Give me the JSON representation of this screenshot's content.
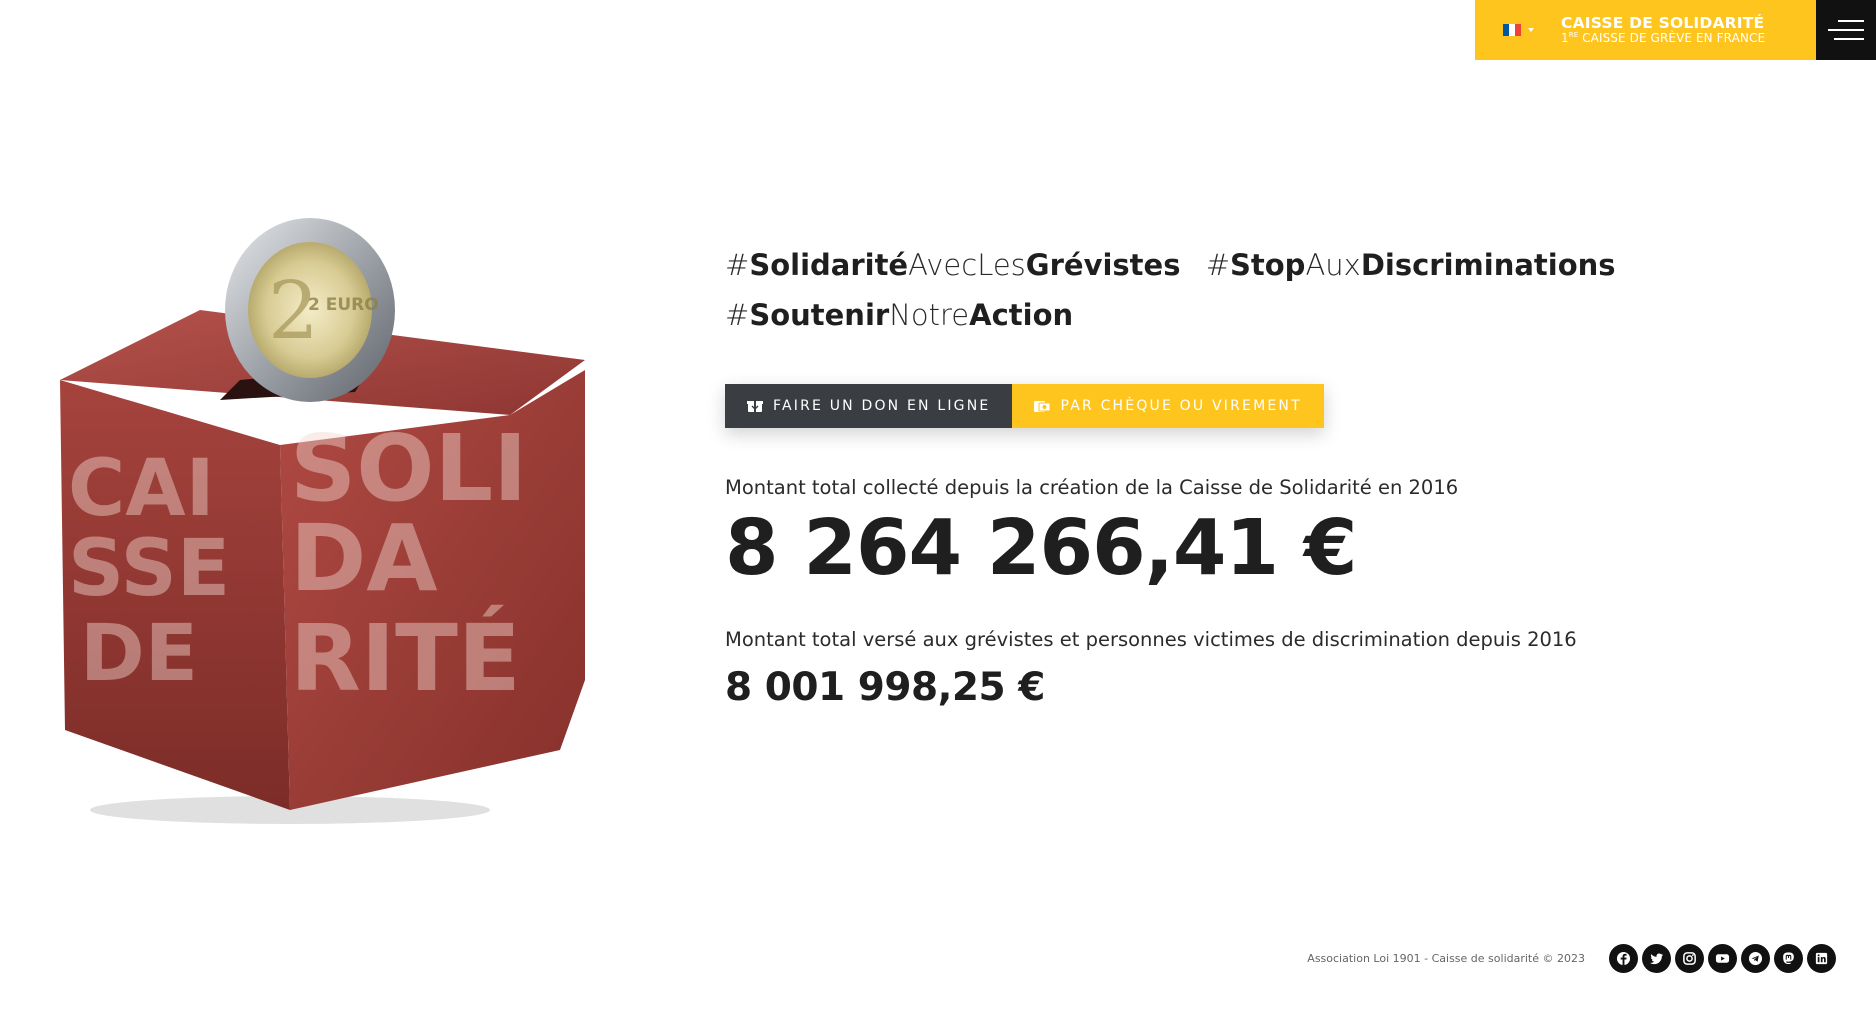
{
  "header": {
    "language": "FR",
    "brand_title": "CAISSE DE SOLIDARITÉ",
    "brand_sub_prefix": "1",
    "brand_sub_sup": "RE",
    "brand_sub_rest": " CAISSE DE GRÈVE EN FRANCE",
    "menu_icon": "hamburger-menu-icon",
    "accent_color": "#ffc51f"
  },
  "illustration": {
    "coin_label": "2 EURO",
    "brick_text": [
      "CAI",
      "SSE",
      "DE",
      "SOLI",
      "DA",
      "RITÉ"
    ]
  },
  "hashtags": [
    {
      "hash": "#",
      "parts": [
        {
          "t": "Solidarité",
          "w": "bold"
        },
        {
          "t": "AvecLes",
          "w": "thin"
        },
        {
          "t": "Grévistes",
          "w": "bold"
        }
      ]
    },
    {
      "hash": "#",
      "parts": [
        {
          "t": "Stop",
          "w": "bold"
        },
        {
          "t": "Aux",
          "w": "thin"
        },
        {
          "t": "Discriminations",
          "w": "bold"
        }
      ]
    },
    {
      "hash": "#",
      "parts": [
        {
          "t": "Soutenir",
          "w": "bold"
        },
        {
          "t": "Notre",
          "w": "thin"
        },
        {
          "t": "Action",
          "w": "bold"
        }
      ]
    }
  ],
  "buttons": {
    "donate_online": "FAIRE UN DON EN LIGNE",
    "donate_online_icon": "gift-box-icon",
    "cheque_transfer": "PAR CHÈQUE OU VIREMENT",
    "cheque_transfer_icon": "money-icon"
  },
  "stats": {
    "collected_label": "Montant total collecté depuis la création de la Caisse de Solidarité en 2016",
    "collected_value": "8 264 266,41 €",
    "paid_label": "Montant total versé aux grévistes et personnes victimes de discrimination depuis 2016",
    "paid_value": "8 001 998,25 €"
  },
  "footer": {
    "copyright": "Association Loi 1901 - Caisse de solidarité © 2023",
    "socials": [
      "facebook-icon",
      "twitter-icon",
      "instagram-icon",
      "youtube-icon",
      "telegram-icon",
      "mastodon-icon",
      "linkedin-icon"
    ]
  }
}
